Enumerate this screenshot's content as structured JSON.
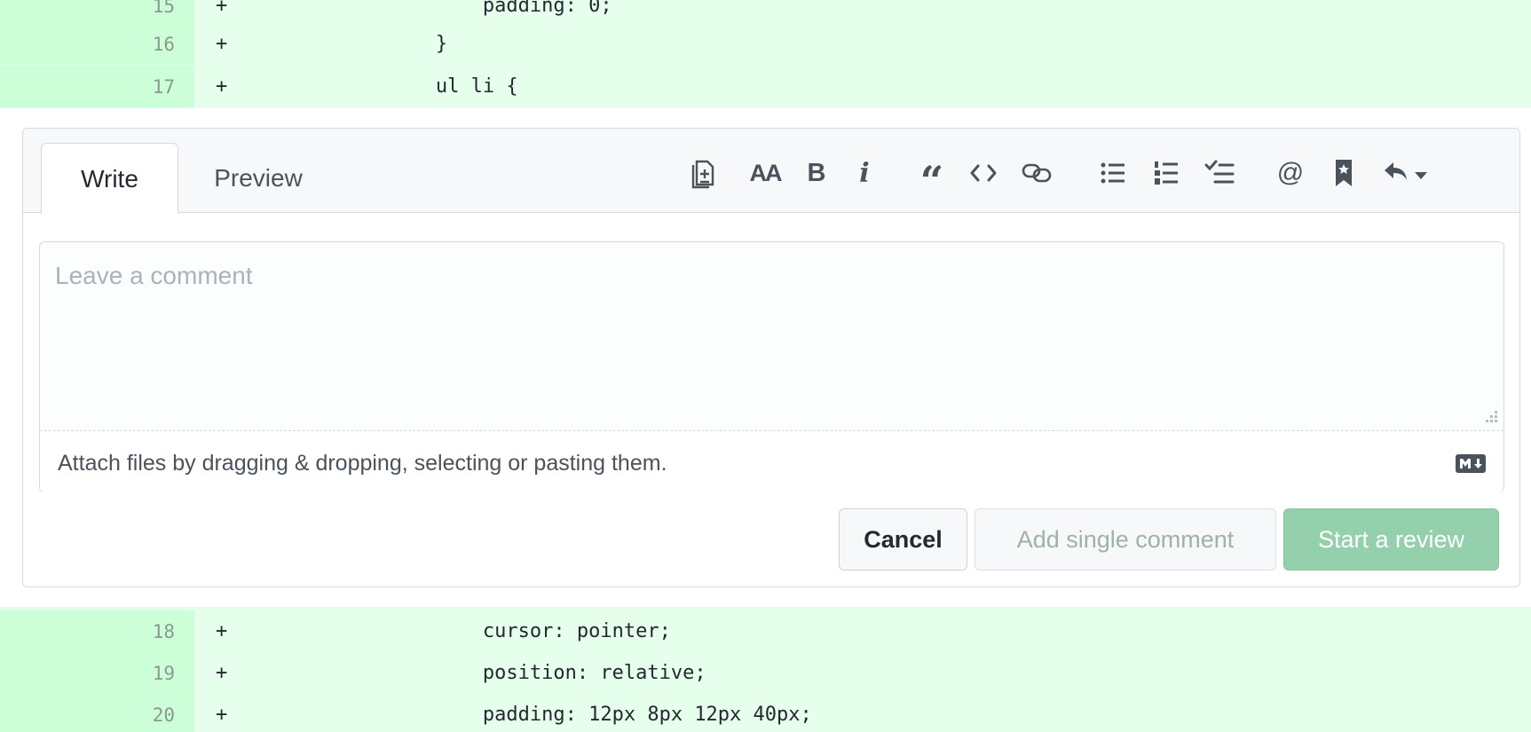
{
  "diff_top": [
    {
      "line": "15",
      "marker": "+",
      "code": "                    padding: 0;"
    },
    {
      "line": "16",
      "marker": "+",
      "code": "                }"
    },
    {
      "line": "17",
      "marker": "+",
      "code": "                ul li {"
    }
  ],
  "diff_bottom": [
    {
      "line": "18",
      "marker": "+",
      "code": "                    cursor: pointer;"
    },
    {
      "line": "19",
      "marker": "+",
      "code": "                    position: relative;"
    },
    {
      "line": "20",
      "marker": "+",
      "code": "                    padding: 12px 8px 12px 40px;"
    }
  ],
  "tabs": {
    "write": "Write",
    "preview": "Preview"
  },
  "toolbar": {
    "heading_label": "AA",
    "bold_label": "B",
    "italic_label": "i",
    "quote_label": "“",
    "mention_label": "@"
  },
  "editor": {
    "placeholder": "Leave a comment",
    "value": "",
    "attach_hint": "Attach files by dragging & dropping, selecting or pasting them."
  },
  "buttons": {
    "cancel": "Cancel",
    "add_single": "Add single comment",
    "start_review": "Start a review"
  },
  "colors": {
    "diff_added_bg": "#e6ffec",
    "diff_gutter_bg": "#ccffd8",
    "primary_disabled": "#93d0ab"
  }
}
